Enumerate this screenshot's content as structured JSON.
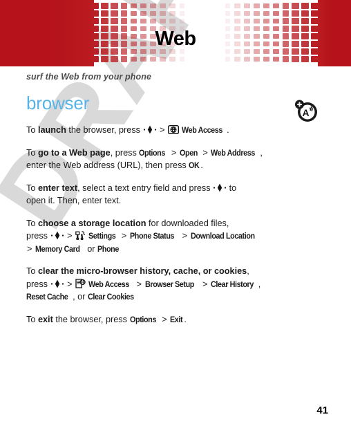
{
  "document": {
    "title": "Web",
    "subtitle": "surf the Web from your phone",
    "section_heading": "browser",
    "page_number": "41",
    "watermark": "DRAFT"
  },
  "theme": {
    "band_red": "#b5121b",
    "heading_blue": "#59b4e6",
    "watermark_gray": "#d9d9d9",
    "subtitle_gray": "#4d4d4d"
  },
  "icons": {
    "nav_key": "nav-key-icon",
    "web_access": "web-access-globe-icon",
    "settings": "settings-tools-icon",
    "webpage": "webpage-globe-icon",
    "corner_marker": "wap-a-signal-icon"
  },
  "instructions": [
    {
      "id": "launch",
      "lines": [
        [
          {
            "t": "text",
            "v": "To "
          },
          {
            "t": "bold",
            "v": "launch"
          },
          {
            "t": "text",
            "v": " the browser, press "
          },
          {
            "t": "icon",
            "v": "nav-key"
          },
          {
            "t": "gt",
            "v": ">"
          },
          {
            "t": "icon",
            "v": "web-access"
          },
          {
            "t": "menu",
            "v": "Web Access"
          },
          {
            "t": "text",
            "v": "."
          }
        ]
      ]
    },
    {
      "id": "go-to-web-page",
      "lines": [
        [
          {
            "t": "text",
            "v": "To "
          },
          {
            "t": "bold",
            "v": "go to a Web page"
          },
          {
            "t": "text",
            "v": ", press "
          },
          {
            "t": "menu",
            "v": "Options"
          },
          {
            "t": "gt",
            "v": ">"
          },
          {
            "t": "menu",
            "v": "Open"
          },
          {
            "t": "gt",
            "v": ">"
          },
          {
            "t": "menu",
            "v": "Web Address"
          },
          {
            "t": "text",
            "v": ","
          }
        ],
        [
          {
            "t": "text",
            "v": "enter the Web address (URL), then press "
          },
          {
            "t": "menu",
            "v": "OK"
          },
          {
            "t": "text",
            "v": "."
          }
        ]
      ]
    },
    {
      "id": "enter-text",
      "lines": [
        [
          {
            "t": "text",
            "v": "To "
          },
          {
            "t": "bold",
            "v": "enter text"
          },
          {
            "t": "text",
            "v": ", select a text entry field and press "
          },
          {
            "t": "icon",
            "v": "nav-key"
          },
          {
            "t": "text",
            "v": " to"
          }
        ],
        [
          {
            "t": "text",
            "v": "open it. Then, enter text."
          }
        ]
      ]
    },
    {
      "id": "choose-storage-location",
      "lines": [
        [
          {
            "t": "text",
            "v": "To "
          },
          {
            "t": "bold",
            "v": "choose a storage location"
          },
          {
            "t": "text",
            "v": " for downloaded files,"
          }
        ],
        [
          {
            "t": "text",
            "v": "press "
          },
          {
            "t": "icon",
            "v": "nav-key"
          },
          {
            "t": "gt",
            "v": ">"
          },
          {
            "t": "icon",
            "v": "settings"
          },
          {
            "t": "menu",
            "v": "Settings"
          },
          {
            "t": "gt",
            "v": ">"
          },
          {
            "t": "menu",
            "v": "Phone Status"
          },
          {
            "t": "gt",
            "v": ">"
          },
          {
            "t": "menu",
            "v": "Download Location"
          }
        ],
        [
          {
            "t": "gt",
            "v": ">"
          },
          {
            "t": "menu",
            "v": "Memory Card"
          },
          {
            "t": "text",
            "v": " or "
          },
          {
            "t": "menu",
            "v": "Phone"
          }
        ]
      ]
    },
    {
      "id": "clear-history",
      "lines": [
        [
          {
            "t": "text",
            "v": "To "
          },
          {
            "t": "bold",
            "v": "clear the micro-browser history, cache, or cookies"
          },
          {
            "t": "text",
            "v": ","
          }
        ],
        [
          {
            "t": "text",
            "v": "press "
          },
          {
            "t": "icon",
            "v": "nav-key"
          },
          {
            "t": "gt",
            "v": ">"
          },
          {
            "t": "icon",
            "v": "webpage"
          },
          {
            "t": "menu",
            "v": "Web Access"
          },
          {
            "t": "gt",
            "v": ">"
          },
          {
            "t": "menu",
            "v": "Browser Setup"
          },
          {
            "t": "gt",
            "v": ">"
          },
          {
            "t": "menu",
            "v": "Clear History"
          },
          {
            "t": "text",
            "v": ","
          }
        ],
        [
          {
            "t": "menu",
            "v": "Reset Cache"
          },
          {
            "t": "text",
            "v": ", or "
          },
          {
            "t": "menu",
            "v": "Clear Cookies"
          }
        ]
      ]
    },
    {
      "id": "exit",
      "lines": [
        [
          {
            "t": "text",
            "v": "To "
          },
          {
            "t": "bold",
            "v": "exit"
          },
          {
            "t": "text",
            "v": " the browser, press "
          },
          {
            "t": "menu",
            "v": "Options"
          },
          {
            "t": "gt",
            "v": ">"
          },
          {
            "t": "menu",
            "v": "Exit"
          },
          {
            "t": "text",
            "v": "."
          }
        ]
      ]
    }
  ]
}
